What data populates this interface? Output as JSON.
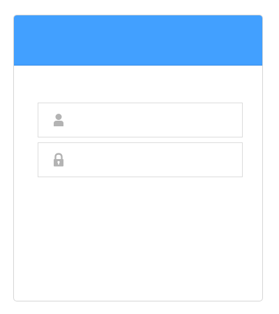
{
  "colors": {
    "header": "#42a0ff",
    "icon": "#b3b3b3",
    "border": "#dcdcdc"
  },
  "form": {
    "username": {
      "icon": "user-icon",
      "value": "",
      "placeholder": ""
    },
    "password": {
      "icon": "lock-icon",
      "value": "",
      "placeholder": ""
    }
  }
}
